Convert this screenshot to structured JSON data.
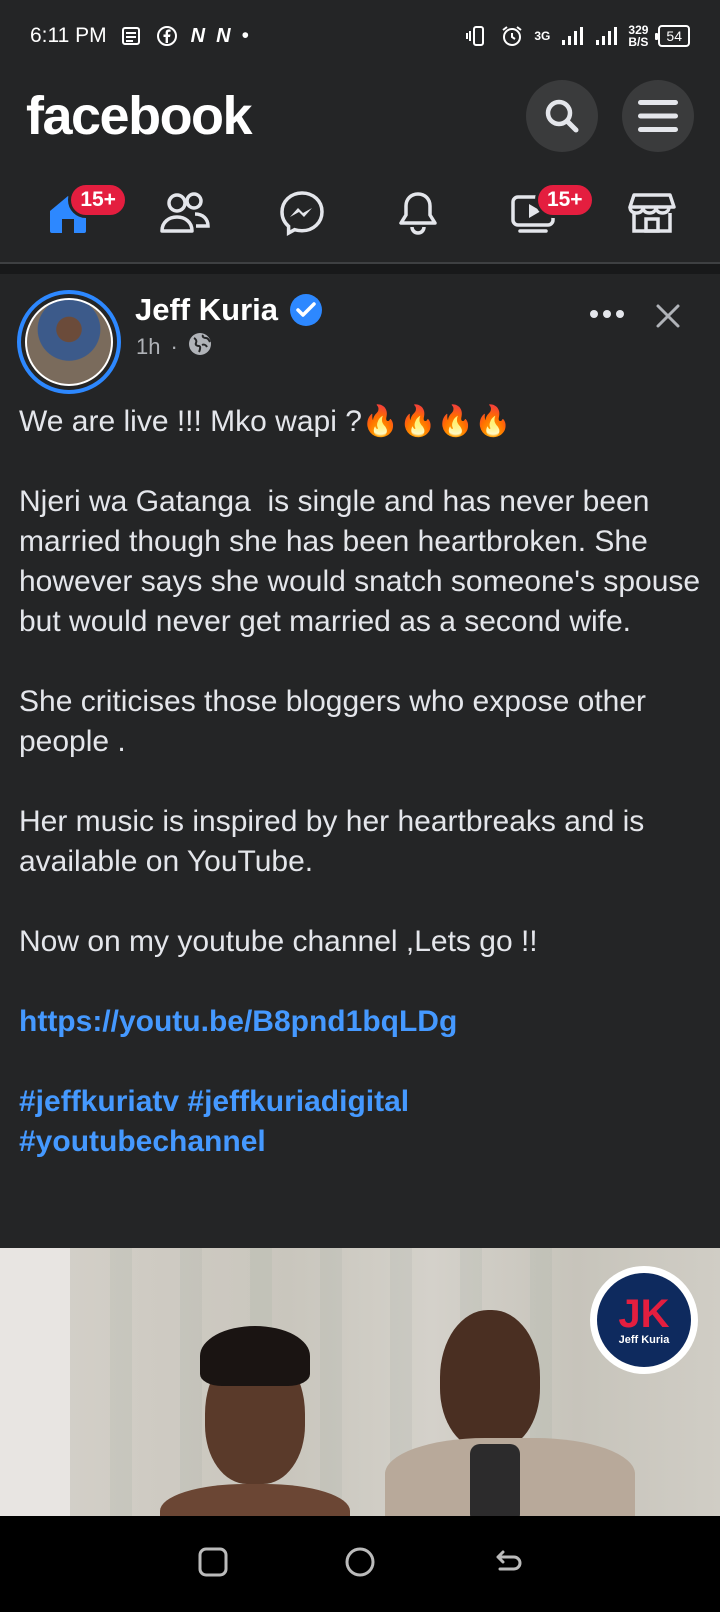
{
  "status_bar": {
    "time": "6:11 PM",
    "network": "3G",
    "speed_value": "329",
    "speed_unit": "B/S",
    "battery": "54"
  },
  "header": {
    "logo_text": "facebook",
    "search_icon": "search-icon",
    "menu_icon": "menu-icon"
  },
  "nav": {
    "home_badge": "15+",
    "video_badge": "15+",
    "items": [
      "home-icon",
      "friends-icon",
      "messenger-icon",
      "notifications-icon",
      "watch-icon",
      "marketplace-icon"
    ]
  },
  "post": {
    "author": "Jeff Kuria",
    "time": "1h",
    "separator": "·",
    "paragraphs": [
      "We are live !!! Mko wapi ?🔥🔥🔥🔥",
      "Njeri wa Gatanga  is single and has never been married though she has been heartbroken. She however says she would snatch someone's spouse but would never get married as a second wife.",
      "She criticises those bloggers who expose other people .",
      "Her music is inspired by her heartbreaks and is available on YouTube.",
      "Now on my youtube channel ,Lets go !!"
    ],
    "link": "https://youtu.be/B8pnd1bqLDg",
    "hashtags_line1": "#jeffkuriatv #jeffkuriadigital",
    "hashtags_line2": "#youtubechannel",
    "image_logo_text": "Jeff Kuria"
  },
  "colors": {
    "background": "#242526",
    "accent": "#2d88ff",
    "link": "#4599ff",
    "badge": "#e41e3f"
  }
}
